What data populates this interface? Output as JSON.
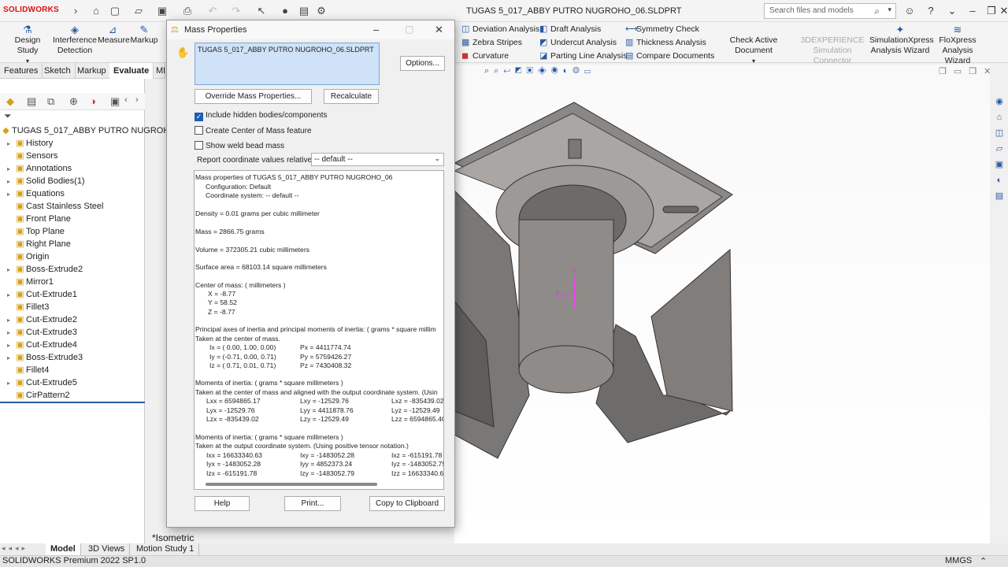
{
  "app": {
    "logo": "SOLIDWORKS",
    "document_title": "TUGAS 5_017_ABBY PUTRO NUGROHO_06.SLDPRT"
  },
  "search": {
    "placeholder": "Search files and models"
  },
  "ribbon": {
    "design_study": "Design Study",
    "interference_detection": "Interference Detection",
    "measure": "Measure",
    "markup": "Markup",
    "deviation_analysis": "Deviation Analysis",
    "zebra_stripes": "Zebra Stripes",
    "curvature": "Curvature",
    "draft_analysis": "Draft Analysis",
    "undercut_analysis": "Undercut Analysis",
    "parting_line_analysis": "Parting Line Analysis",
    "symmetry_check": "Symmetry Check",
    "thickness_analysis": "Thickness Analysis",
    "compare_documents": "Compare Documents",
    "check_active_document": "Check Active Document",
    "experience_connector": "3DEXPERIENCE Simulation Connector",
    "simulationxpress": "SimulationXpress Analysis Wizard",
    "floxpress": "FloXpress Analysis Wizard"
  },
  "cm_tabs": [
    "Features",
    "Sketch",
    "Markup",
    "Evaluate",
    "MB"
  ],
  "feature_tree": {
    "root": "TUGAS 5_017_ABBY PUTRO NUGROH",
    "items": [
      {
        "label": "History",
        "expand": true
      },
      {
        "label": "Sensors",
        "expand": false
      },
      {
        "label": "Annotations",
        "expand": true
      },
      {
        "label": "Solid Bodies(1)",
        "expand": true
      },
      {
        "label": "Equations",
        "expand": true
      },
      {
        "label": "Cast Stainless Steel",
        "expand": false
      },
      {
        "label": "Front Plane",
        "expand": false
      },
      {
        "label": "Top Plane",
        "expand": false
      },
      {
        "label": "Right Plane",
        "expand": false
      },
      {
        "label": "Origin",
        "expand": false
      },
      {
        "label": "Boss-Extrude2",
        "expand": true
      },
      {
        "label": "Mirror1",
        "expand": false
      },
      {
        "label": "Cut-Extrude1",
        "expand": true
      },
      {
        "label": "Fillet3",
        "expand": false
      },
      {
        "label": "Cut-Extrude2",
        "expand": true
      },
      {
        "label": "Cut-Extrude3",
        "expand": true
      },
      {
        "label": "Cut-Extrude4",
        "expand": true
      },
      {
        "label": "Boss-Extrude3",
        "expand": true
      },
      {
        "label": "Fillet4",
        "expand": false
      },
      {
        "label": "Cut-Extrude5",
        "expand": true
      },
      {
        "label": "CirPattern2",
        "expand": false
      }
    ]
  },
  "dialog": {
    "title": "Mass Properties",
    "selection": "TUGAS 5_017_ABBY PUTRO NUGROHO_06.SLDPRT",
    "options": "Options...",
    "override": "Override Mass Properties...",
    "recalculate": "Recalculate",
    "include_hidden": "Include hidden bodies/components",
    "create_com": "Create Center of Mass feature",
    "show_weld": "Show weld bead mass",
    "report_label": "Report coordinate values relative to:",
    "coord_value": "-- default --",
    "help": "Help",
    "print": "Print...",
    "copy": "Copy to Clipboard",
    "results": {
      "l01": "Mass properties of TUGAS 5_017_ABBY PUTRO NUGROHO_06",
      "l02": "Configuration: Default",
      "l03": "Coordinate system: -- default --",
      "l04": "Density = 0.01 grams per cubic millimeter",
      "l05": "Mass = 2866.75 grams",
      "l06": "Volume = 372305.21 cubic millimeters",
      "l07": "Surface area = 68103.14  square millimeters",
      "l08": "Center of mass: ( millimeters )",
      "l09": "X = -8.77",
      "l10": "Y = 58.52",
      "l11": "Z = -8.77",
      "l12": "Principal axes of inertia and principal moments of inertia: ( grams *  square millim",
      "l13": "Taken at the center of mass.",
      "l14a": "Ix = ( 0.00,  1.00,  0.00)",
      "l14b": "Px = 4411774.74",
      "l15a": "Iy = (-0.71,  0.00,  0.71)",
      "l15b": "Py = 5759426.27",
      "l16a": "Iz = ( 0.71,  0.01,  0.71)",
      "l16b": "Pz = 7430408.32",
      "l17": "Moments of inertia: ( grams *  square millimeters )",
      "l18": "Taken at the center of mass and aligned with the output coordinate system. (Usin",
      "l19a": "Lxx = 6594865.17",
      "l19b": "Lxy = -12529.76",
      "l19c": "Lxz = -835439.02",
      "l20a": "Lyx = -12529.76",
      "l20b": "Lyy = 4411878.76",
      "l20c": "Lyz = -12529.49",
      "l21a": "Lzx = -835439.02",
      "l21b": "Lzy = -12529.49",
      "l21c": "Lzz = 6594865.4C",
      "l22": "Moments of inertia: ( grams *  square millimeters )",
      "l23": "Taken at the output coordinate system. (Using positive tensor notation.)",
      "l24a": "Ixx = 16633340.63",
      "l24b": "Ixy = -1483052.28",
      "l24c": "Ixz = -615191.78",
      "l25a": "Iyx = -1483052.28",
      "l25b": "Iyy = 4852373.24",
      "l25c": "Iyz = -1483052.7!",
      "l26a": "Izx = -615191.78",
      "l26b": "Izy = -1483052.79",
      "l26c": "Izz = 16633340.6"
    }
  },
  "viewport": {
    "view_label": "*Isometric",
    "axis_y": "Y",
    "axis_z": "Z"
  },
  "bottom_tabs": [
    "Model",
    "3D Views",
    "Motion Study 1"
  ],
  "status": {
    "left": "SOLIDWORKS Premium 2022 SP1.0",
    "units": "MMGS"
  }
}
